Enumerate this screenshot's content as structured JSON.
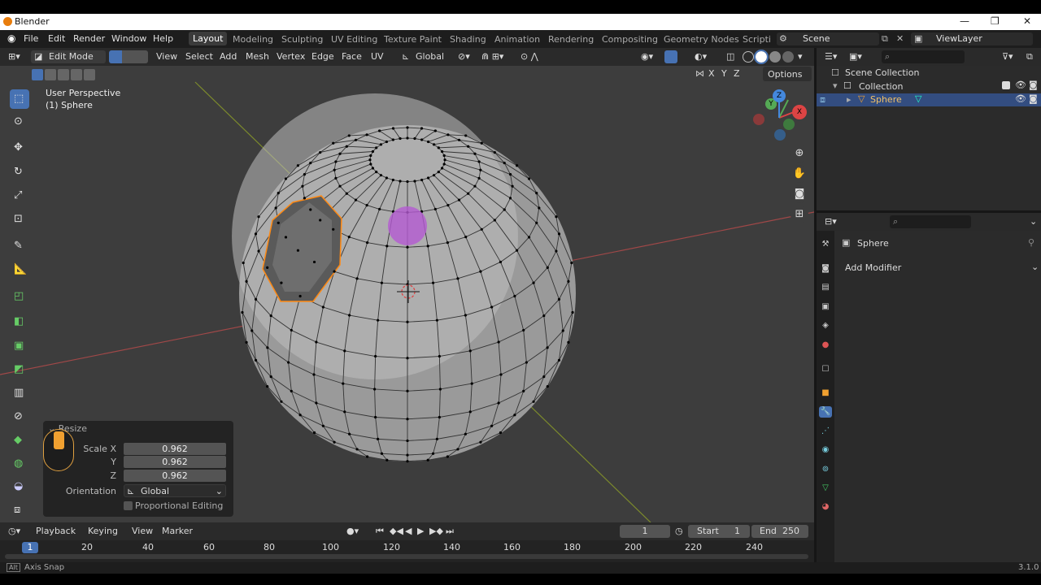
{
  "app": {
    "title": "Blender",
    "version": "3.1.0"
  },
  "window_controls": {
    "minimize": "—",
    "maximize": "❐",
    "close": "✕"
  },
  "menu": [
    "File",
    "Edit",
    "Render",
    "Window",
    "Help"
  ],
  "workspaces": [
    "Layout",
    "Modeling",
    "Sculpting",
    "UV Editing",
    "Texture Paint",
    "Shading",
    "Animation",
    "Rendering",
    "Compositing",
    "Geometry Nodes",
    "Scripti"
  ],
  "scene": {
    "name": "Scene",
    "view_layer": "ViewLayer"
  },
  "viewport_header": {
    "mode": "Edit Mode",
    "menus": [
      "View",
      "Select",
      "Add",
      "Mesh",
      "Vertex",
      "Edge",
      "Face",
      "UV"
    ],
    "transform_orientation": "Global",
    "axes": [
      "X",
      "Y",
      "Z"
    ],
    "options": "Options"
  },
  "viewport": {
    "perspective": "User Perspective",
    "object_info": "(1) Sphere"
  },
  "gizmo": {
    "x": "X",
    "y": "Y",
    "z": "Z"
  },
  "redo_panel": {
    "title": "Resize",
    "scale_x_label": "Scale X",
    "scale_y_label": "Y",
    "scale_z_label": "Z",
    "scale_x": "0.962",
    "scale_y": "0.962",
    "scale_z": "0.962",
    "orientation_label": "Orientation",
    "orientation": "Global",
    "proportional_editing": "Proportional Editing"
  },
  "timeline": {
    "menus": [
      "Playback",
      "Keying",
      "View",
      "Marker"
    ],
    "current_frame": "1",
    "start_label": "Start",
    "start": "1",
    "end_label": "End",
    "end": "250",
    "ticks": [
      "1",
      "20",
      "40",
      "60",
      "80",
      "100",
      "120",
      "140",
      "160",
      "180",
      "200",
      "220",
      "240"
    ]
  },
  "outliner": {
    "scene_collection": "Scene Collection",
    "collection": "Collection",
    "object": "Sphere"
  },
  "properties": {
    "object": "Sphere",
    "add_modifier": "Add Modifier"
  },
  "statusbar": {
    "hint": "Axis Snap",
    "version": "3.1.0"
  },
  "colors": {
    "accent": "#4772b3",
    "selection": "#ff8a14",
    "viewport_bg": "#3d3d3d",
    "brush_circle": "#b45ad2"
  }
}
